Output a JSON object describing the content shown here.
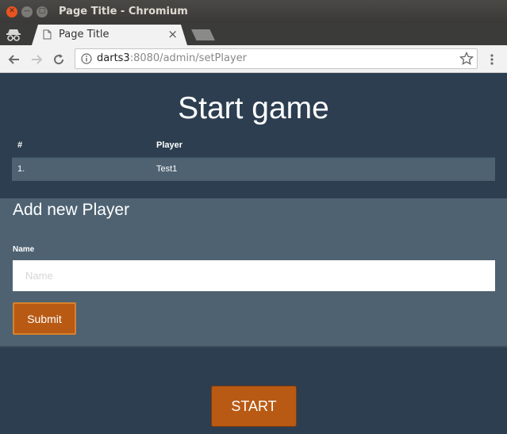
{
  "window": {
    "title": "Page Title - Chromium"
  },
  "tabs": [
    {
      "label": "Page Title",
      "close_glyph": "×"
    }
  ],
  "omnibox": {
    "host": "darts3",
    "rest": ":8080/admin/setPlayer"
  },
  "page": {
    "heading": "Start game",
    "table": {
      "headers": [
        "#",
        "Player"
      ],
      "rows": [
        {
          "num": "1.",
          "player": "Test1"
        }
      ]
    },
    "form": {
      "title": "Add new Player",
      "name_label": "Name",
      "name_placeholder": "Name",
      "name_value": "",
      "submit_label": "Submit"
    },
    "start_label": "START"
  },
  "colors": {
    "page_bg": "#2c3e50",
    "panel_bg": "#4e6272",
    "button_bg": "#b85a14",
    "ubuntu_close": "#e95420"
  },
  "icons": [
    "close-window-icon",
    "minimize-window-icon",
    "maximize-window-icon",
    "incognito-icon",
    "page-favicon-icon",
    "back-arrow-icon",
    "forward-arrow-icon",
    "reload-icon",
    "info-icon",
    "star-icon",
    "menu-icon"
  ]
}
